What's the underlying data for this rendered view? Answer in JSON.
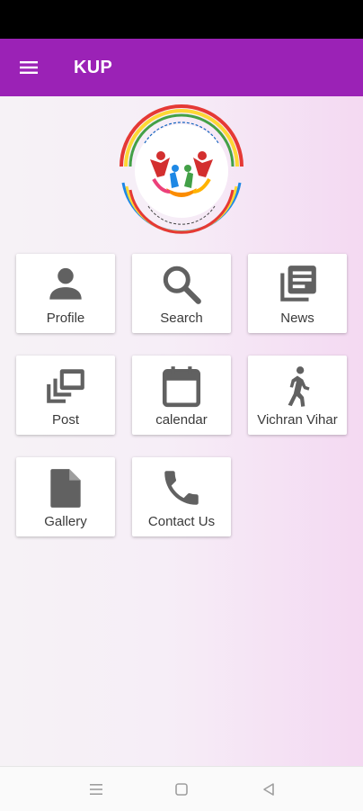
{
  "app_bar": {
    "title": "KUP",
    "menu_icon": "menu-icon"
  },
  "logo": {
    "name": "kup-emblem"
  },
  "tiles": [
    {
      "label": "Profile",
      "icon": "person-icon"
    },
    {
      "label": "Search",
      "icon": "search-icon"
    },
    {
      "label": "News",
      "icon": "news-icon"
    },
    {
      "label": "Post",
      "icon": "post-icon"
    },
    {
      "label": "calendar",
      "icon": "calendar-icon"
    },
    {
      "label": "Vichran Vihar",
      "icon": "walk-icon"
    },
    {
      "label": "Gallery",
      "icon": "file-icon"
    },
    {
      "label": "Contact Us",
      "icon": "phone-icon"
    }
  ],
  "colors": {
    "accent": "#9b22b6",
    "icon_gray": "#616161",
    "label": "#3a3a3a"
  },
  "nav_bar": {
    "buttons": [
      "menu-nav-icon",
      "home-square-icon",
      "back-triangle-icon"
    ]
  }
}
